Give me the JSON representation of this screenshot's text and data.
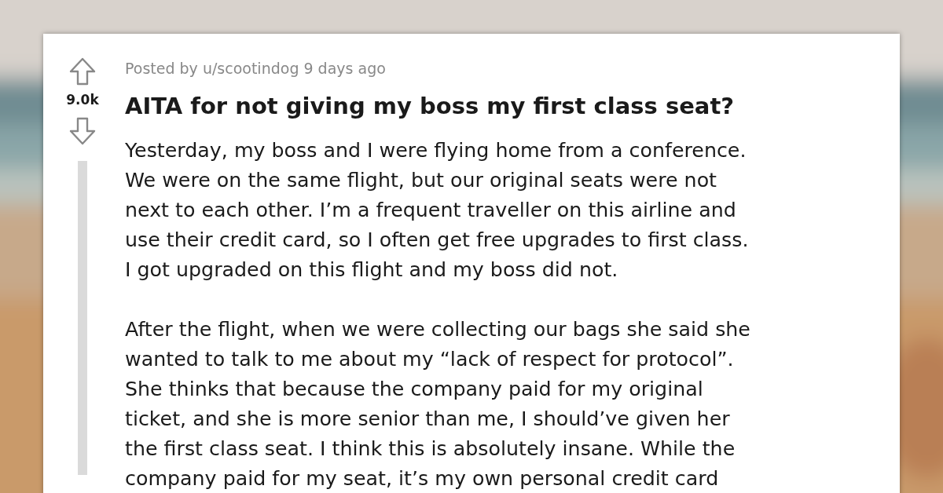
{
  "post": {
    "upvote_count": "9.0k",
    "meta": "Posted by u/scootindog 9 days ago",
    "title": "AITA for not giving my boss my first class seat?",
    "paragraphs": [
      {
        "lines": [
          "Yesterday, my boss and I were flying home from a conference.",
          "We were on the same flight, but our original seats were not",
          "next to each other. I’m a frequent traveller on this airline and",
          "use their credit card, so I often get free upgrades to first class.",
          "I got upgraded on this flight and my boss did not."
        ]
      },
      {
        "lines": [
          "After the flight, when we were collecting our bags she said she",
          "wanted to talk to me about my “lack of respect for protocol”.",
          "She thinks that because the company paid for my original",
          "ticket, and she is more senior than me, I should’ve given her",
          "the first class seat. I think this is absolutely insane. While the",
          "company paid for my seat, it’s my own personal credit card"
        ]
      }
    ]
  }
}
